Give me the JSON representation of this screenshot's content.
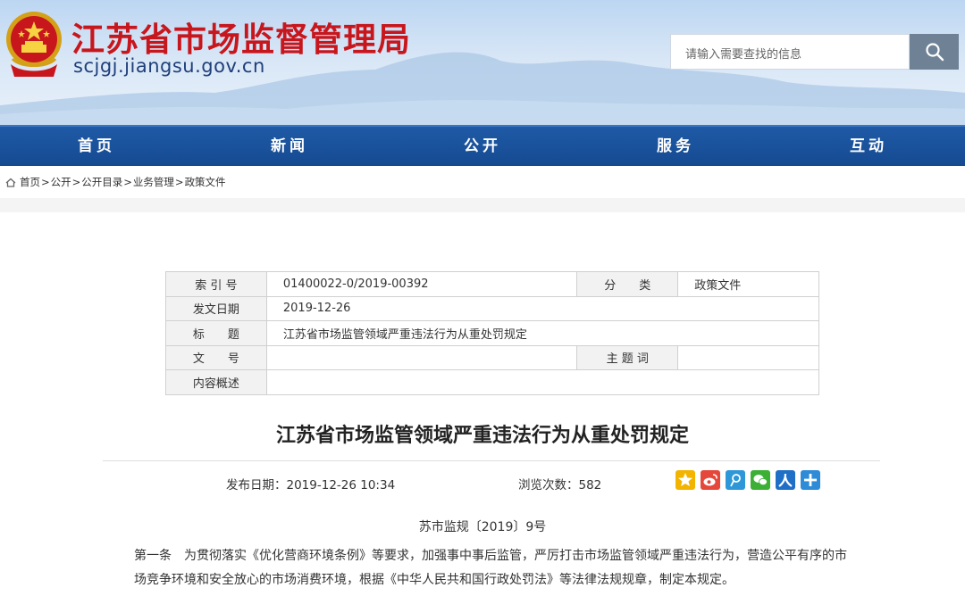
{
  "header": {
    "site_title": "江苏省市场监督管理局",
    "site_domain": "scjgj.jiangsu.gov.cn",
    "search_placeholder": "请输入需要查找的信息"
  },
  "nav": {
    "items": [
      "首页",
      "新闻",
      "公开",
      "服务",
      "互动"
    ]
  },
  "breadcrumb": {
    "items": [
      "首页",
      "公开",
      "公开目录",
      "业务管理",
      "政策文件"
    ],
    "separator": ">"
  },
  "meta": {
    "index_label": "索 引 号",
    "index_value": "01400022-0/2019-00392",
    "category_label": "分　　类",
    "category_value": "政策文件",
    "date_label": "发文日期",
    "date_value": "2019-12-26",
    "title_label": "标　　题",
    "title_value": "江苏省市场监管领域严重违法行为从重处罚规定",
    "docno_label": "文　　号",
    "docno_value": "",
    "keywords_label": "主 题 词",
    "keywords_value": "",
    "summary_label": "内容概述",
    "summary_value": ""
  },
  "article": {
    "title": "江苏省市场监管领域严重违法行为从重处罚规定",
    "publish_label": "发布日期：",
    "publish_value": "2019-12-26 10:34",
    "views_label": "浏览次数：",
    "views_value": "582",
    "doc_number": "苏市监规〔2019〕9号",
    "para1_line1": "第一条　为贯彻落实《优化营商环境条例》等要求，加强事中事后监管，严厉打击市场监管领域严重违法行为，营造公平有序的市",
    "para1_line2": "场竞争环境和安全放心的市场消费环境，根据《中华人民共和国行政处罚法》等法律法规规章，制定本规定。"
  },
  "share_icons": [
    "qzone-icon",
    "weibo-icon",
    "tencent-weibo-icon",
    "wechat-icon",
    "renren-icon",
    "more-share-icon"
  ],
  "colors": {
    "title_red": "#c8161d",
    "nav_blue": "#1a52a0"
  }
}
